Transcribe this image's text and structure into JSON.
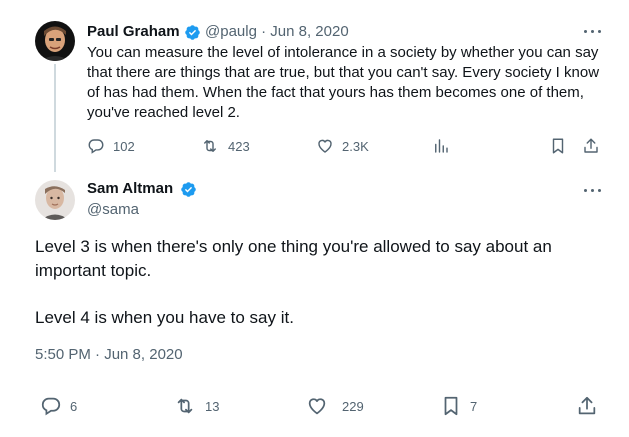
{
  "parent_tweet": {
    "author_name": "Paul Graham",
    "handle_date": "@paulg · Jun 8, 2020",
    "text": "You can measure the level of intolerance in a society by whether you can say that there are things that are true, but that you can't say. Every society I know of has had them. When the fact that yours has them becomes one of them, you've reached level 2.",
    "replies": "102",
    "retweets": "423",
    "likes": "2.3K"
  },
  "main_tweet": {
    "author_name": "Sam Altman",
    "handle": "@sama",
    "paragraph_1": "Level 3 is when there's only one thing you're allowed to say about an important topic.",
    "paragraph_2": "Level 4 is when you have to say it.",
    "timestamp": "5:50 PM · Jun 8, 2020",
    "replies": "6",
    "retweets": "13",
    "likes": "229",
    "bookmarks": "7"
  },
  "colors": {
    "verified": "#1d9bf0",
    "muted": "#536471",
    "text": "#0f1419",
    "thread_line": "#cfd9de"
  },
  "icons": [
    "comment-icon",
    "retweet-icon",
    "heart-icon",
    "views-icon",
    "bookmark-icon",
    "share-icon",
    "verified-badge-icon",
    "more-options-icon"
  ]
}
